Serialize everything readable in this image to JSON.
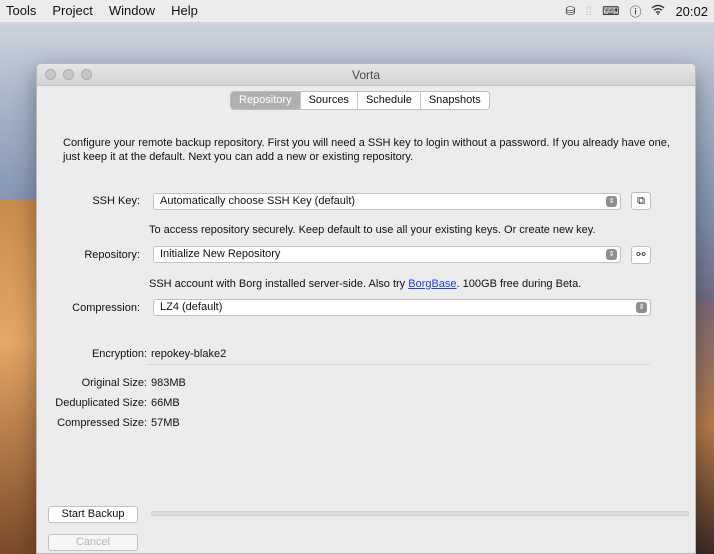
{
  "menubar": {
    "items": [
      "Tools",
      "Project",
      "Window",
      "Help"
    ],
    "clock": "20:02"
  },
  "window": {
    "title": "Vorta",
    "tabs": [
      {
        "label": "Repository",
        "active": true
      },
      {
        "label": "Sources",
        "active": false
      },
      {
        "label": "Schedule",
        "active": false
      },
      {
        "label": "Snapshots",
        "active": false
      }
    ],
    "intro": "Configure your remote backup repository. First you will need a SSH key to login without a password. If you already have one, just keep it at the default. Next you can add a new or existing repository.",
    "ssh_key": {
      "label": "SSH Key:",
      "value": "Automatically choose SSH Key (default)",
      "hint": "To access repository securely. Keep default to use all your existing keys. Or create new key."
    },
    "repository": {
      "label": "Repository:",
      "value": "Initialize New Repository",
      "hint_prefix": "SSH account with Borg installed server-side. Also try ",
      "hint_link": "BorgBase",
      "hint_suffix": ". 100GB free during Beta."
    },
    "compression": {
      "label": "Compression:",
      "value": "LZ4 (default)"
    },
    "encryption": {
      "label": "Encryption:",
      "value": "repokey-blake2"
    },
    "sizes": [
      {
        "label": "Original Size:",
        "value": "983MB"
      },
      {
        "label": "Deduplicated Size:",
        "value": "66MB"
      },
      {
        "label": "Compressed Size:",
        "value": "57MB"
      }
    ],
    "start_backup": "Start Backup",
    "cancel": "Cancel",
    "progress": 0
  },
  "colors": {
    "link": "#1b3fe0",
    "active_tab": "#b0b0b0",
    "window_bg": "#ececec"
  }
}
